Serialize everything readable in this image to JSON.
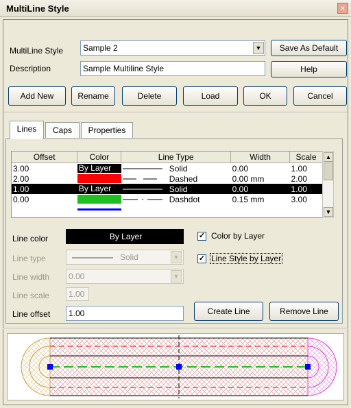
{
  "window": {
    "title": "MultiLine Style",
    "close_glyph": "×"
  },
  "top": {
    "style_label": "MultiLine Style",
    "style_value": "Sample 2",
    "description_label": "Description",
    "description_value": "Sample Multiline Style",
    "save_default": "Save As Default",
    "help": "Help"
  },
  "actions": {
    "add_new": "Add New",
    "rename": "Rename",
    "delete": "Delete",
    "load": "Load",
    "ok": "OK",
    "cancel": "Cancel"
  },
  "tabs": [
    "Lines",
    "Caps",
    "Properties"
  ],
  "grid": {
    "headers": [
      "Offset",
      "Color",
      "Line Type",
      "Width",
      "Scale"
    ],
    "rows": [
      {
        "offset": "3.00",
        "color": "By Layer",
        "color_hex": "#000000",
        "linetype": "Solid",
        "width": "0.00",
        "scale": "1.00",
        "selected": false
      },
      {
        "offset": "2.00",
        "color": "",
        "color_hex": "#ff0000",
        "linetype": "Dashed",
        "width": "0.00 mm",
        "scale": "2.00",
        "selected": false
      },
      {
        "offset": "1.00",
        "color": "By Layer",
        "color_hex": "#000000",
        "linetype": "Solid",
        "width": "0.00",
        "scale": "1.00",
        "selected": true
      },
      {
        "offset": "0.00",
        "color": "",
        "color_hex": "#1fbf1f",
        "linetype": "Dashdot",
        "width": "0.15 mm",
        "scale": "3.00",
        "selected": false
      }
    ]
  },
  "props": {
    "line_color_label": "Line color",
    "line_color_value": "By Layer",
    "line_type_label": "Line type",
    "line_type_value": "Solid",
    "line_width_label": "Line width",
    "line_width_value": "0.00",
    "line_scale_label": "Line scale",
    "line_scale_value": "1.00",
    "line_offset_label": "Line offset",
    "line_offset_value": "1.00",
    "color_by_layer": "Color by Layer",
    "style_by_layer": "Line Style by Layer",
    "create_line": "Create Line",
    "remove_line": "Remove Line"
  },
  "colors": {
    "accent": "#003c74",
    "selection": "#000000",
    "handle": "#0000ff"
  }
}
